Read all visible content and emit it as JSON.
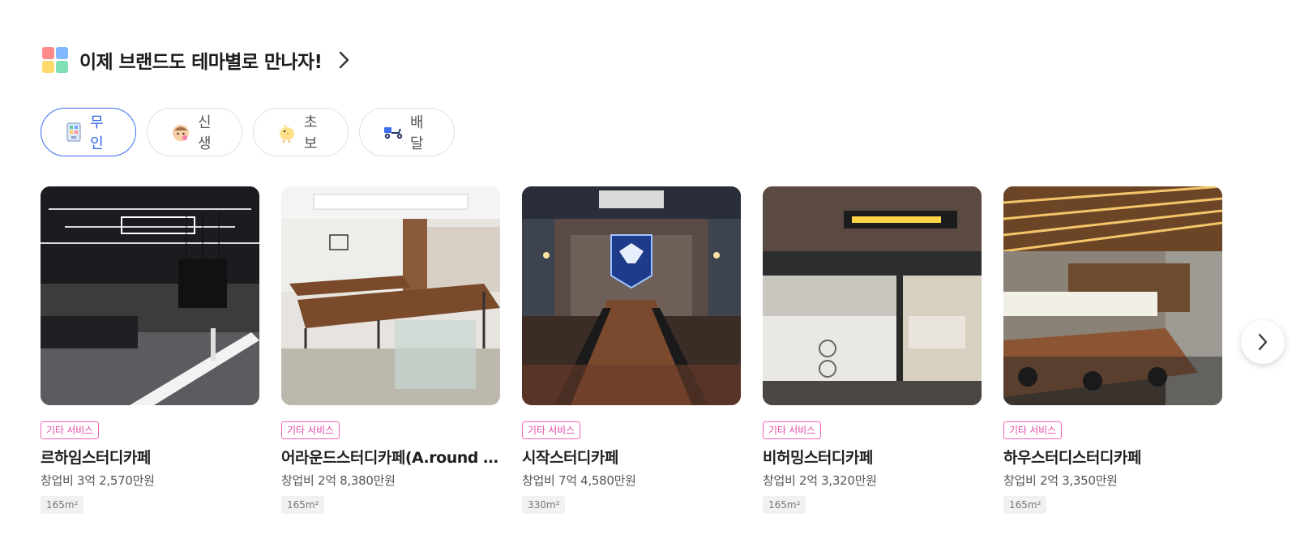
{
  "header": {
    "title": "이제 브랜드도 테마별로 만나자!",
    "icon": "colorful-grid-icon",
    "chevron_icon": "chevron-right-icon"
  },
  "tabs": [
    {
      "label": "무인",
      "icon": "kiosk-icon",
      "active": true
    },
    {
      "label": "신생",
      "icon": "baby-icon",
      "active": false
    },
    {
      "label": "초보",
      "icon": "chick-icon",
      "active": false
    },
    {
      "label": "배달",
      "icon": "scooter-icon",
      "active": false
    }
  ],
  "cards": [
    {
      "badge": "기타 서비스",
      "name": "르하임스터디카페",
      "cost": "창업비 3억 2,570만원",
      "area": "165m²"
    },
    {
      "badge": "기타 서비스",
      "name": "어라운드스터디카페(A.round s...",
      "cost": "창업비 2억 8,380만원",
      "area": "165m²"
    },
    {
      "badge": "기타 서비스",
      "name": "시작스터디카페",
      "cost": "창업비 7억 4,580만원",
      "area": "330m²"
    },
    {
      "badge": "기타 서비스",
      "name": "비허밍스터디카페",
      "cost": "창업비 2억 3,320만원",
      "area": "165m²"
    },
    {
      "badge": "기타 서비스",
      "name": "하우스터디스터디카페",
      "cost": "창업비 2억 3,350만원",
      "area": "165m²"
    }
  ],
  "next_button": {
    "icon": "chevron-right-icon"
  },
  "colors": {
    "accent_blue": "#2f63e8",
    "badge_pink": "#e24aa6",
    "text_dark": "#1f1f1f"
  }
}
